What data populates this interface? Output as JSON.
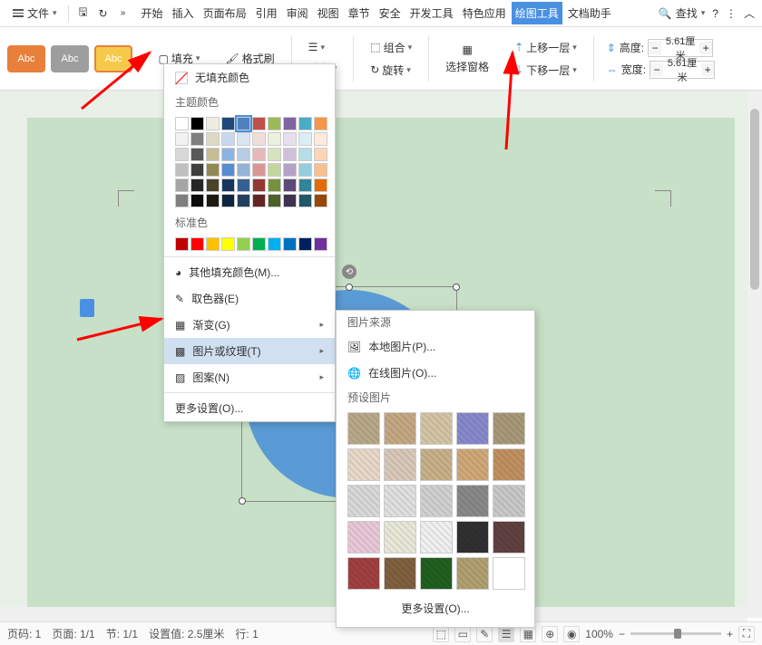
{
  "toolbar": {
    "file": "文件",
    "tabs": [
      "开始",
      "插入",
      "页面布局",
      "引用",
      "审阅",
      "视图",
      "章节",
      "安全",
      "开发工具",
      "特色应用",
      "绘图工具",
      "文档助手"
    ],
    "active_tab": 10,
    "search": "查找"
  },
  "ribbon": {
    "shape_label": "Abc",
    "fill": "填充",
    "format_painter": "格式刷",
    "align": "对齐",
    "group": "组合",
    "rotate": "旋转",
    "select_pane": "选择窗格",
    "bring_forward": "上移一层",
    "send_backward": "下移一层",
    "height_label": "高度:",
    "width_label": "宽度:",
    "height_val": "5.61厘米",
    "width_val": "5.61厘米"
  },
  "fill_menu": {
    "no_fill": "无填充颜色",
    "theme_colors": "主题颜色",
    "standard_colors": "标准色",
    "more_colors": "其他填充颜色(M)...",
    "eyedropper": "取色器(E)",
    "gradient": "渐变(G)",
    "picture_texture": "图片或纹理(T)",
    "pattern": "图案(N)",
    "more_settings": "更多设置(O)...",
    "theme_grid": [
      [
        "#ffffff",
        "#000000",
        "#eeece1",
        "#1f497d",
        "#4f81bd",
        "#c0504d",
        "#9bbb59",
        "#8064a2",
        "#4bacc6",
        "#f79646"
      ],
      [
        "#f2f2f2",
        "#7f7f7f",
        "#ddd9c3",
        "#c6d9f0",
        "#dbe5f1",
        "#f2dcdb",
        "#ebf1dd",
        "#e5e0ec",
        "#dbeef3",
        "#fdeada"
      ],
      [
        "#d8d8d8",
        "#595959",
        "#c4bd97",
        "#8db3e2",
        "#b8cce4",
        "#e5b9b7",
        "#d7e3bc",
        "#ccc1d9",
        "#b7dde8",
        "#fbd5b5"
      ],
      [
        "#bfbfbf",
        "#3f3f3f",
        "#938953",
        "#548dd4",
        "#95b3d7",
        "#d99694",
        "#c3d69b",
        "#b2a2c7",
        "#92cddc",
        "#fac08f"
      ],
      [
        "#a5a5a5",
        "#262626",
        "#494429",
        "#17365d",
        "#366092",
        "#953734",
        "#76923c",
        "#5f497a",
        "#31859b",
        "#e36c09"
      ],
      [
        "#7f7f7f",
        "#0c0c0c",
        "#1d1b10",
        "#0f243e",
        "#244061",
        "#632423",
        "#4f6128",
        "#3f3151",
        "#205867",
        "#974806"
      ]
    ],
    "standard_grid": [
      "#c00000",
      "#ff0000",
      "#ffc000",
      "#ffff00",
      "#92d050",
      "#00b050",
      "#00b0f0",
      "#0070c0",
      "#002060",
      "#7030a0"
    ]
  },
  "submenu": {
    "source": "图片来源",
    "local": "本地图片(P)...",
    "online": "在线图片(O)...",
    "preset": "预设图片",
    "more": "更多设置(O)...",
    "textures": [
      "#b8a888",
      "#c4a884",
      "#d4c4a4",
      "#8888cc",
      "#a89878",
      "#e8d8c8",
      "#d8c8b8",
      "#c8b088",
      "#d0a878",
      "#c09060",
      "#d8d8d8",
      "#e0e0e0",
      "#d0d0d0",
      "#888888",
      "#c8c8c8",
      "#e8c8d8",
      "#e8e8d8",
      "#f0f0f0",
      "#303030",
      "#604040",
      "#a04040",
      "#806040",
      "#206020",
      "#b0a070",
      "#ffffff"
    ]
  },
  "statusbar": {
    "page_num": "页码: 1",
    "page": "页面: 1/1",
    "section": "节: 1/1",
    "indent": "设置值: 2.5厘米",
    "row_label": "行: 1",
    "zoom": "100%"
  }
}
